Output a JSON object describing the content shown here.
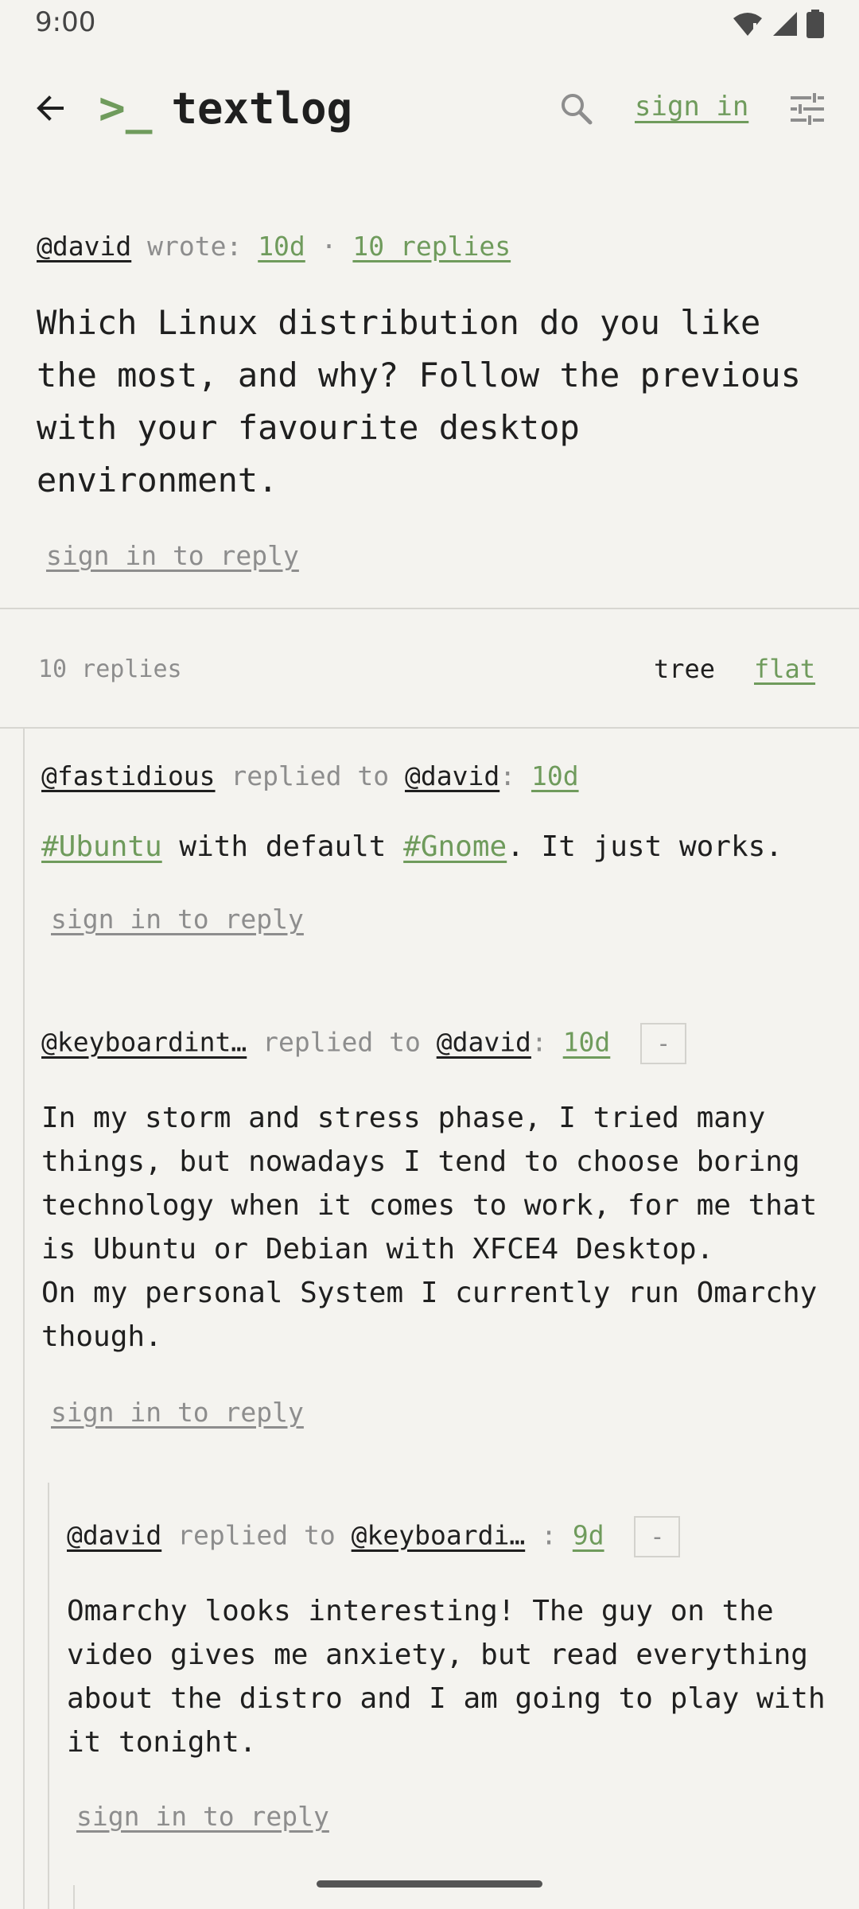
{
  "status": {
    "time": "9:00"
  },
  "app": {
    "prompt": ">_",
    "name": "textlog",
    "signin": "sign in"
  },
  "post": {
    "author": "@david",
    "wrote": "wrote:",
    "age": "10d",
    "sep": "·",
    "replies_link": "10 replies",
    "body": "Which Linux distribution do you like the most, and why? Follow the previous with your favourite desktop environment.",
    "reply_link": "sign in to reply"
  },
  "replies_bar": {
    "count": "10 replies",
    "tree": "tree",
    "flat": "flat"
  },
  "replies": [
    {
      "author": "@fastidious",
      "replied_to_label": "replied to",
      "target": "@david",
      "age": "10d",
      "body_tag1": "#Ubuntu",
      "body_mid": " with default ",
      "body_tag2": "#Gnome",
      "body_end": ". It just works.",
      "reply_link": "sign in to reply"
    },
    {
      "author": "@keyboardint…",
      "replied_to_label": "replied to",
      "target": "@david",
      "age": "10d",
      "collapse": "-",
      "body": "In my storm and stress phase, I tried many\nthings, but nowadays I tend to choose boring\ntechnology when it comes to work, for me that\nis Ubuntu or Debian with XFCE4 Desktop.\nOn my personal System I currently run Omarchy\nthough.",
      "reply_link": "sign in to reply"
    },
    {
      "author": "@david",
      "replied_to_label": "replied to",
      "target": "@keyboardi…",
      "age": "9d",
      "collapse": "-",
      "body": "Omarchy looks interesting! The guy on the\nvideo gives me anxiety, but read everything\nabout the distro and I am going to play with\nit tonight.",
      "reply_link": "sign in to reply"
    }
  ]
}
